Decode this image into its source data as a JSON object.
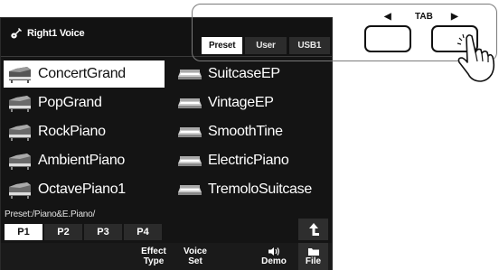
{
  "screen": {
    "title": "Right1 Voice",
    "title_icon": "guitar-icon",
    "tabs": [
      {
        "label": "Preset",
        "active": true
      },
      {
        "label": "User",
        "active": false
      },
      {
        "label": "USB1",
        "active": false
      }
    ],
    "voices": [
      {
        "name": "ConcertGrand",
        "icon": "grand-piano-icon",
        "selected": true
      },
      {
        "name": "SuitcaseEP",
        "icon": "electric-piano-icon",
        "selected": false
      },
      {
        "name": "PopGrand",
        "icon": "grand-piano-icon",
        "selected": false
      },
      {
        "name": "VintageEP",
        "icon": "electric-piano-icon",
        "selected": false
      },
      {
        "name": "RockPiano",
        "icon": "grand-piano-icon",
        "selected": false
      },
      {
        "name": "SmoothTine",
        "icon": "electric-piano-icon",
        "selected": false
      },
      {
        "name": "AmbientPiano",
        "icon": "grand-piano-icon",
        "selected": false
      },
      {
        "name": "ElectricPiano",
        "icon": "electric-piano-icon",
        "selected": false
      },
      {
        "name": "OctavePiano1",
        "icon": "grand-piano-icon",
        "selected": false
      },
      {
        "name": "TremoloSuitcase",
        "icon": "electric-piano-icon",
        "selected": false
      }
    ],
    "path": "Preset:/Piano&E.Piano/",
    "pages": [
      {
        "label": "P1",
        "active": true
      },
      {
        "label": "P2",
        "active": false
      },
      {
        "label": "P3",
        "active": false
      },
      {
        "label": "P4",
        "active": false
      }
    ],
    "functions": {
      "effect_type_line1": "Effect",
      "effect_type_line2": "Type",
      "voice_set_line1": "Voice",
      "voice_set_line2": "Set",
      "demo": "Demo",
      "file": "File"
    }
  },
  "panel": {
    "tab_label": "TAB",
    "left_arrow": "◀",
    "right_arrow": "▶"
  },
  "colors": {
    "screen_bg": "#141414",
    "selected_bg": "#ffffff",
    "inactive_tab_bg": "#2c2c2c"
  }
}
